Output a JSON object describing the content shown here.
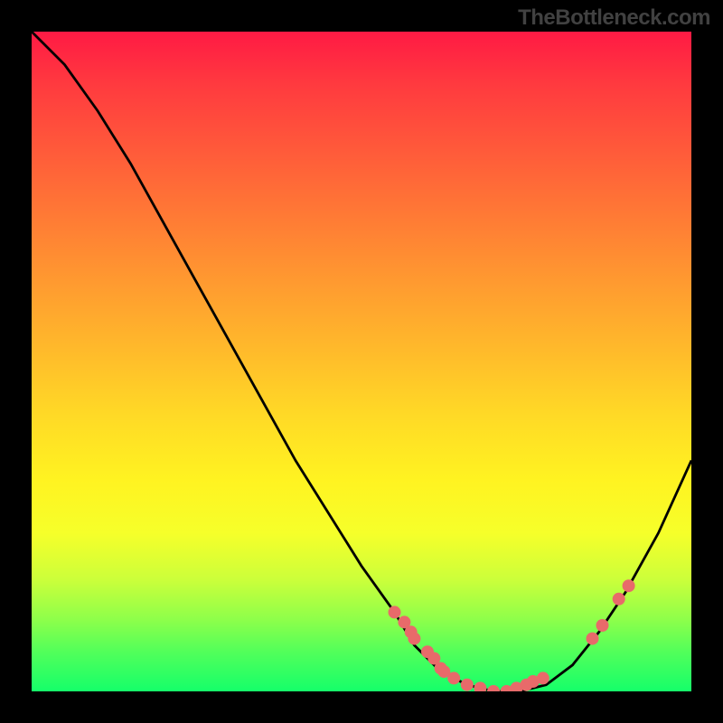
{
  "watermark": "TheBottleneck.com",
  "chart_data": {
    "type": "line",
    "title": "",
    "xlabel": "",
    "ylabel": "",
    "xlim": [
      0,
      100
    ],
    "ylim": [
      0,
      100
    ],
    "grid": false,
    "legend": false,
    "series": [
      {
        "name": "curve",
        "x": [
          0,
          5,
          10,
          15,
          20,
          25,
          30,
          35,
          40,
          45,
          50,
          55,
          58,
          62,
          66,
          70,
          74,
          78,
          82,
          86,
          90,
          95,
          100
        ],
        "y": [
          100,
          95,
          88,
          80,
          71,
          62,
          53,
          44,
          35,
          27,
          19,
          12,
          7,
          3,
          1,
          0,
          0,
          1,
          4,
          9,
          15,
          24,
          35
        ]
      },
      {
        "name": "dots",
        "type": "scatter",
        "x": [
          55,
          56.5,
          57.5,
          58,
          60,
          61,
          62,
          62.5,
          64,
          66,
          68,
          70,
          72,
          73.5,
          75,
          76,
          77.5,
          85,
          86.5,
          89,
          90.5
        ],
        "y": [
          12,
          10.5,
          9,
          8,
          6,
          5,
          3.5,
          3,
          2,
          1,
          0.5,
          0,
          0,
          0.5,
          1,
          1.5,
          2,
          8,
          10,
          14,
          16
        ]
      }
    ],
    "colors": {
      "curve": "#000000",
      "dots": "#e86a6a",
      "gradient_top": "#ff1a44",
      "gradient_bottom": "#15ff6a"
    }
  }
}
